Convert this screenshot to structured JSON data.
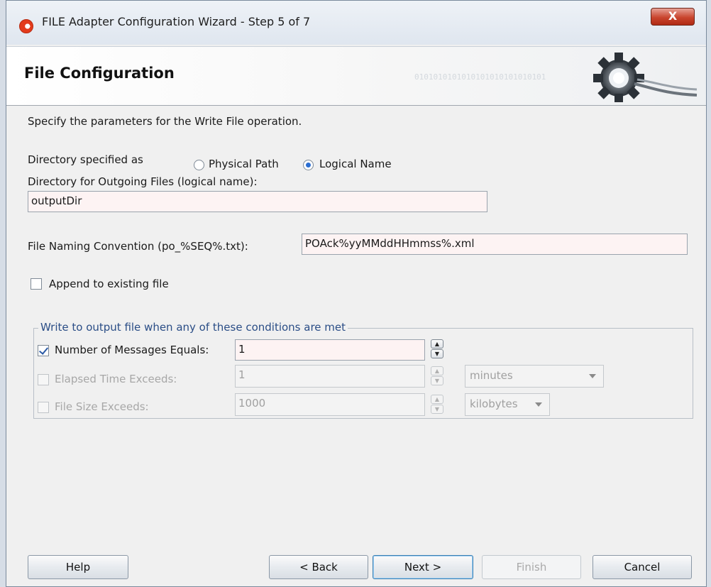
{
  "window": {
    "title": "FILE Adapter Configuration Wizard - Step 5 of 7",
    "close_glyph": "X"
  },
  "header": {
    "title": "File Configuration",
    "binary_text": "0101010101010101010101010101"
  },
  "intro": "Specify the parameters for the Write File operation.",
  "directory": {
    "label": "Directory specified as",
    "options": [
      {
        "label": "Physical Path",
        "selected": false
      },
      {
        "label": "Logical Name",
        "selected": true
      }
    ],
    "outgoing_label": "Directory for Outgoing Files (logical name):",
    "outgoing_value": "outputDir"
  },
  "file_naming": {
    "label": "File Naming Convention (po_%SEQ%.txt):",
    "value": "POAck%yyMMddHHmmss%.xml"
  },
  "append": {
    "label": "Append to existing file",
    "checked": false
  },
  "conditions": {
    "legend": "Write to output file when any of these conditions are met",
    "rows": [
      {
        "label": "Number of Messages Equals:",
        "checked": true,
        "enabled": true,
        "value": "1",
        "unit": ""
      },
      {
        "label": "Elapsed Time Exceeds:",
        "checked": false,
        "enabled": false,
        "value": "1",
        "unit": "minutes"
      },
      {
        "label": "File Size Exceeds:",
        "checked": false,
        "enabled": false,
        "value": "1000",
        "unit": "kilobytes"
      }
    ]
  },
  "footer": {
    "help": "Help",
    "back": "< Back",
    "next": "Next >",
    "finish": "Finish",
    "cancel": "Cancel"
  }
}
